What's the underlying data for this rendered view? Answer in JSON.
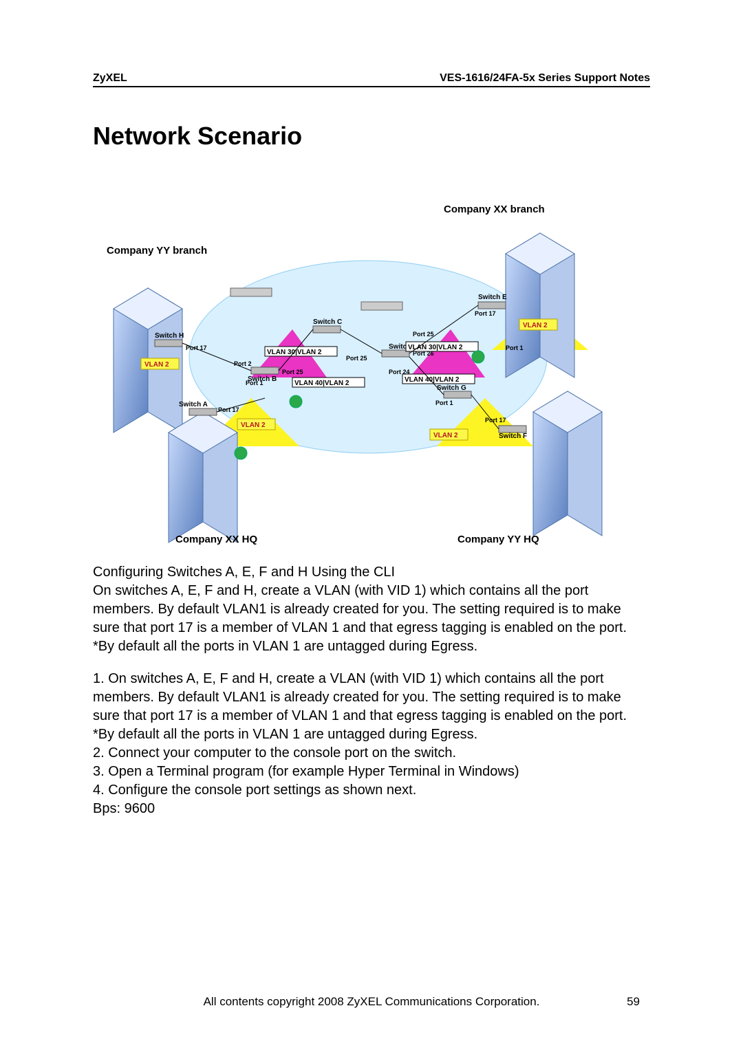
{
  "header": {
    "brand": "ZyXEL",
    "series": "VES-1616/24FA-5x Series Support Notes"
  },
  "title": "Network Scenario",
  "diagram": {
    "locations": {
      "xx_branch": "Company XX branch",
      "yy_branch": "Company YY branch",
      "xx_hq": "Company XX HQ",
      "yy_hq": "Company YY HQ"
    },
    "switches": {
      "a": "Switch A",
      "b": "Switch B",
      "c": "Switch C",
      "d": "Switch D",
      "e": "Switch E",
      "f": "Switch F",
      "g": "Switch G",
      "h": "Switch H"
    },
    "vlan_labels": {
      "vlan2": "VLAN 2",
      "vlan30_2": "VLAN 30|VLAN 2",
      "vlan40_2": "VLAN 40|VLAN 2"
    },
    "port_labels": {
      "p17": "Port 17",
      "p25": "Port 25",
      "p26": "Port 26",
      "p24": "Port 24",
      "p1": "Port 1",
      "p2": "Port 2"
    }
  },
  "body": {
    "intro_heading": "Configuring Switches A, E, F and H Using the CLI",
    "intro_para": "On switches A, E, F and H, create a VLAN (with VID 1) which contains all the port members. By default VLAN1 is already created for you. The setting required is to make sure that port 17 is a member of VLAN 1 and that egress tagging is enabled on the port.",
    "intro_note": "*By default all the ports in VLAN 1 are untagged during Egress.",
    "step1": "1. On switches A, E, F and H, create a VLAN (with VID 1) which contains all the port members. By default VLAN1 is already created for you. The setting required is to make sure that port 17 is a member of VLAN 1 and that egress tagging is enabled on the port.",
    "step1_note": "*By default all the ports in VLAN 1 are untagged during Egress.",
    "step2": "2. Connect your computer to the console port on the switch.",
    "step3": "3. Open a Terminal program (for example Hyper Terminal in Windows)",
    "step4": "4. Configure the console port settings as shown next.",
    "bps": "Bps: 9600"
  },
  "footer": {
    "copyright": "All contents copyright 2008 ZyXEL Communications Corporation.",
    "page": "59"
  }
}
